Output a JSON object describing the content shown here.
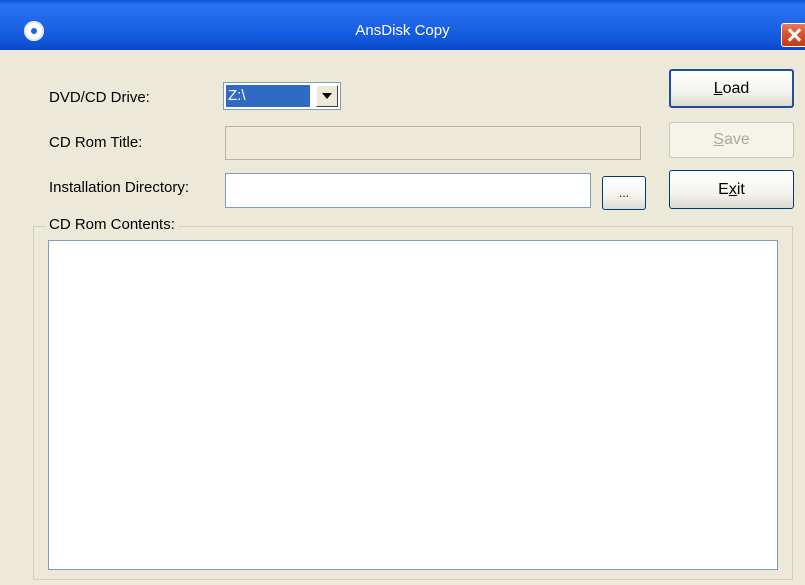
{
  "window": {
    "title": "AnsDisk Copy"
  },
  "form": {
    "drive_label": "DVD/CD Drive:",
    "drive_value": "Z:\\",
    "title_label": "CD Rom Title:",
    "title_value": "",
    "install_dir_label": "Installation Directory:",
    "install_dir_value": "",
    "browse_label": "...",
    "contents_label": "CD Rom Contents:"
  },
  "buttons": {
    "load": {
      "mnemonic": "L",
      "rest": "oad"
    },
    "save": {
      "mnemonic": "S",
      "rest": "ave",
      "enabled": false
    },
    "exit": {
      "before": "E",
      "mnemonic": "x",
      "rest": "it"
    }
  },
  "icons": {
    "app": "disc-icon",
    "close": "close-icon",
    "dropdown": "chevron-down-icon"
  },
  "colors": {
    "titlebar": "#1d63e6",
    "selection": "#316ac5",
    "close": "#d9532f",
    "dialog_bg": "#ece9d8"
  }
}
